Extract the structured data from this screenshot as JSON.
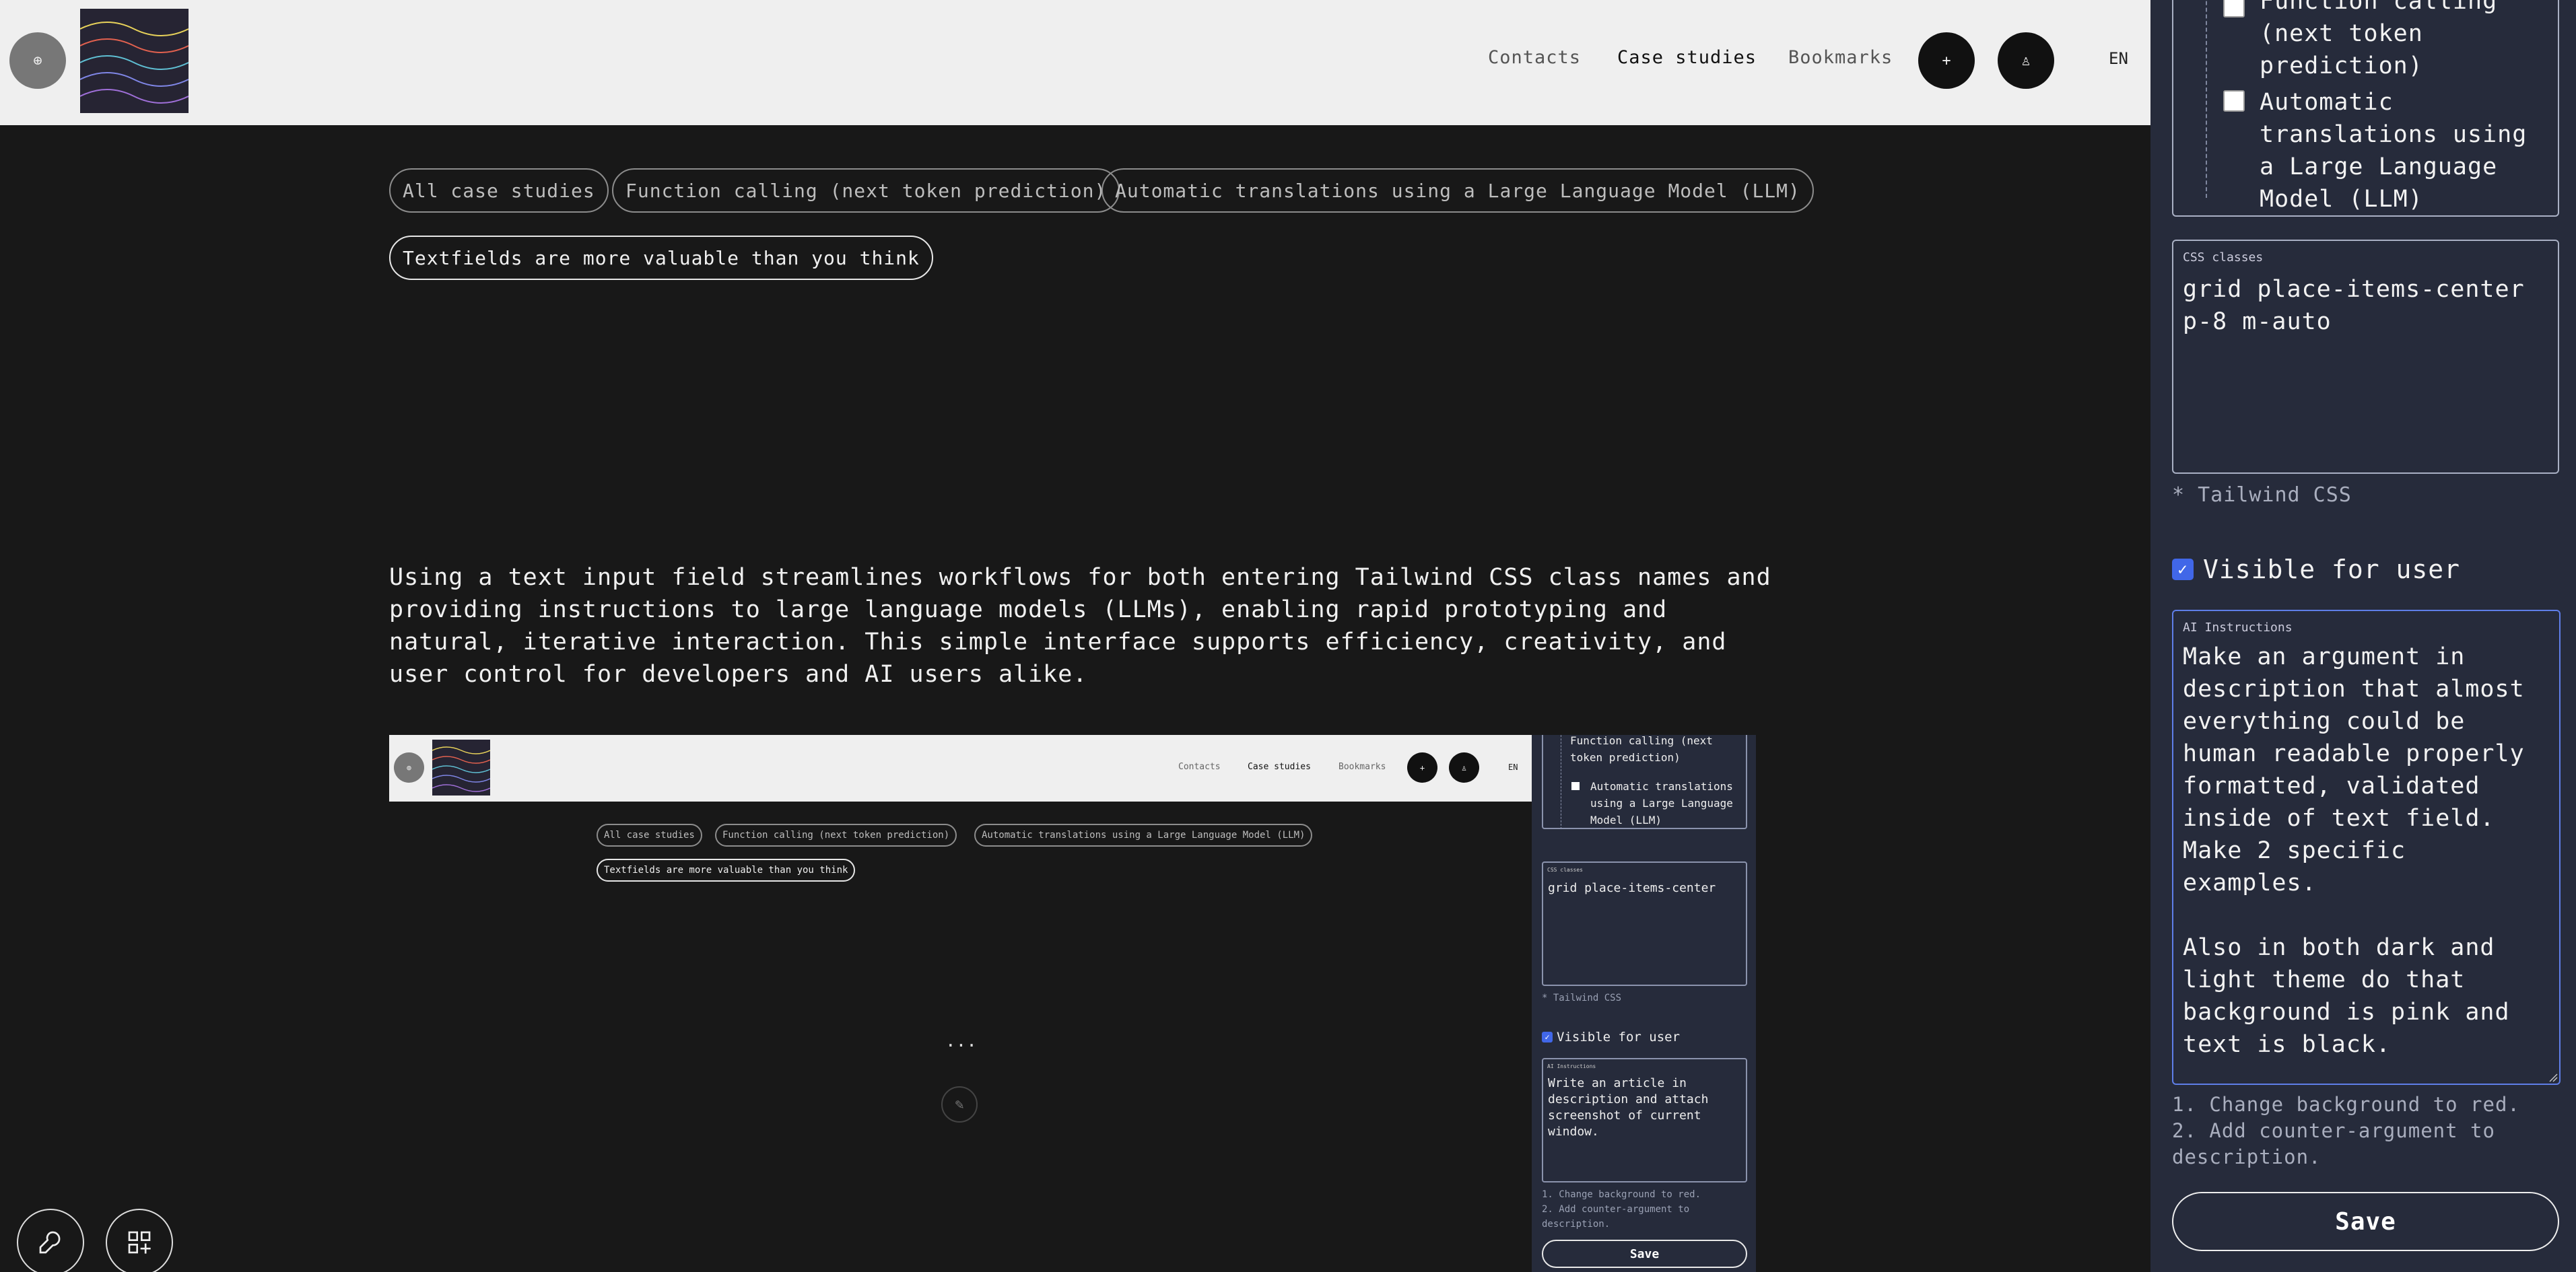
{
  "header": {
    "logo_icon": "⊕",
    "nav": [
      "Contacts",
      "Case studies",
      "Bookmarks"
    ],
    "plus_icon": "+",
    "user_icon": "♙",
    "lang": "EN"
  },
  "pills": [
    "All case studies",
    "Function calling (next token prediction)",
    "Automatic translations using a Large Language Model (LLM)",
    "Textfields are more valuable than you think"
  ],
  "description": "Using a text input field streamlines workflows for both entering Tailwind CSS class names and providing instructions to large language models (LLMs), enabling rapid prototyping and natural, iterative interaction. This simple interface supports efficiency, creativity, and user control for developers and AI users alike.",
  "preview": {
    "dots": "...",
    "checkbox_items": [
      "Function calling (next token prediction)",
      "Automatic translations using a Large Language Model (LLM)"
    ],
    "css_label": "CSS classes",
    "css_value": "grid place-items-center",
    "tailwind_note": "* Tailwind CSS",
    "visible_label": "Visible for user",
    "ai_label": "AI Instructions",
    "ai_value": "Write an article in description and attach screenshot of current window.",
    "hints": [
      "1. Change background to red.",
      "2. Add counter-argument to description."
    ],
    "save_label": "Save"
  },
  "panel": {
    "checkbox_items": [
      "Function calling (next token prediction)",
      "Automatic translations using a Large Language Model (LLM)"
    ],
    "css_label": "CSS classes",
    "css_value": "grid place-items-center p-8 m-auto",
    "tailwind_note": "* Tailwind CSS",
    "visible_label": "Visible for user",
    "ai_label": "AI Instructions",
    "ai_value": "Make an argument in description that almost everything could be human readable properly formatted, validated inside of text field. Make 2 specific examples.\n\nAlso in both dark and light theme do that background is pink and text is black.",
    "hints": [
      "1. Change background to red.",
      "2. Add counter-argument to description."
    ],
    "save_label": "Save"
  },
  "tools": {
    "wrench_icon": "🔧",
    "add_grid_icon": "⊞"
  },
  "colors": {
    "accent": "#4167e8",
    "panel_bg": "#262b3b",
    "page_bg": "#181818",
    "header_bg": "#efefef"
  }
}
